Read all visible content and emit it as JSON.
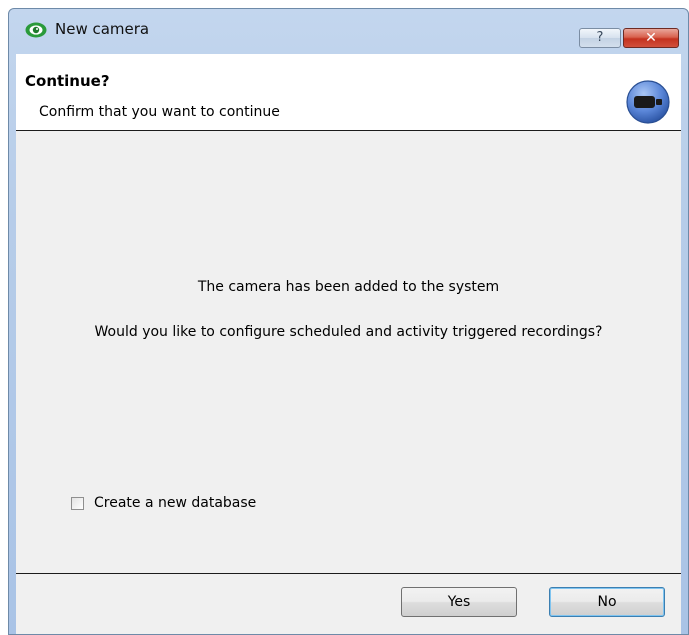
{
  "window": {
    "title": "New camera",
    "help_glyph": "?",
    "close_glyph": "✕"
  },
  "header": {
    "title": "Continue?",
    "subtitle": "Confirm that you want to continue",
    "icon": "camera-icon"
  },
  "body": {
    "message_1": "The camera has been added to the system",
    "message_2": "Would you like to configure scheduled and activity triggered recordings?",
    "checkbox": {
      "label": "Create a new database",
      "checked": false
    }
  },
  "buttons": {
    "yes_label": "Yes",
    "no_label": "No"
  },
  "icons": {
    "app": "eye-icon",
    "help": "help-icon",
    "close": "close-icon"
  },
  "colors": {
    "titlebar": "#b7cde9",
    "close_button": "#c4321f",
    "dialog_background": "#f0f0f0",
    "header_background": "#ffffff",
    "header_icon": "#5a86d8"
  }
}
